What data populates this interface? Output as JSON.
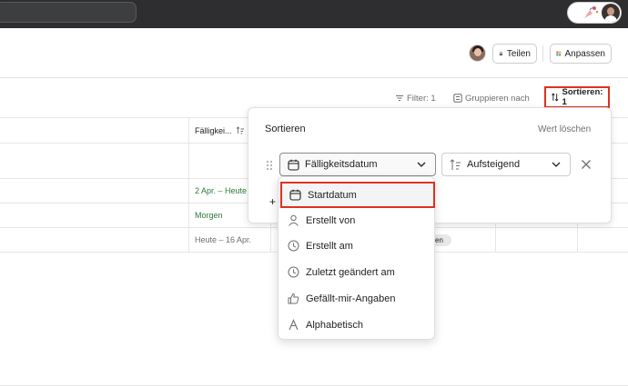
{
  "header": {
    "share_label": "Teilen",
    "customize_label": "Anpassen"
  },
  "toolbar": {
    "filter_label": "Filter: 1",
    "group_label": "Gruppieren nach",
    "sort_label": "Sortieren: 1"
  },
  "table": {
    "column_header": "Fälligkei...",
    "rows": [
      {
        "due": "2 Apr. – Heute"
      },
      {
        "due": "Morgen"
      },
      {
        "due": "Heute – 16 Apr."
      }
    ],
    "tag_label": "en"
  },
  "sort_panel": {
    "title": "Sortieren",
    "clear_label": "Wert löschen",
    "field_value": "Fälligkeitsdatum",
    "order_value": "Aufsteigend",
    "add_symbol": "+"
  },
  "dropdown": {
    "items": [
      {
        "label": "Startdatum",
        "icon": "calendar-icon"
      },
      {
        "label": "Erstellt von",
        "icon": "person-icon"
      },
      {
        "label": "Erstellt am",
        "icon": "clock-icon"
      },
      {
        "label": "Zuletzt geändert am",
        "icon": "clock-icon"
      },
      {
        "label": "Gefällt-mir-Angaben",
        "icon": "thumbs-up-icon"
      },
      {
        "label": "Alphabetisch",
        "icon": "alphabet-icon"
      }
    ]
  },
  "colors": {
    "topbar": "#2e2e30",
    "highlight": "#e0301e",
    "due_green": "#2c7a3b"
  }
}
